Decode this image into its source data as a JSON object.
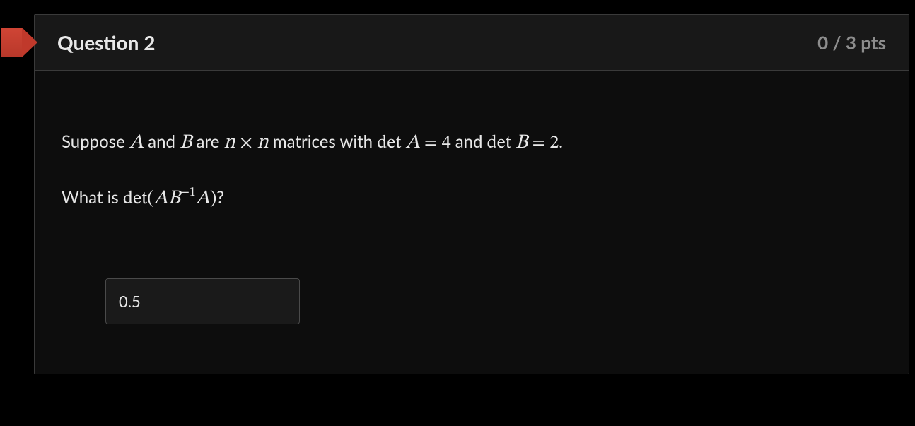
{
  "header": {
    "title": "Question 2",
    "points": "0 / 3 pts"
  },
  "body": {
    "line1_pre": "Suppose ",
    "A": "A",
    "and1": " and ",
    "B": "B",
    "are": " are ",
    "n1": "n",
    "times": " × ",
    "n2": "n",
    "mid1": " matrices with ",
    "det1": "det",
    "sp1": " ",
    "A2": "A",
    "eq1": " = ",
    "v1": "4",
    "and2": " and ",
    "det2": "det",
    "sp2": " ",
    "B2": "B",
    "eq2": " = ",
    "v2": "2",
    "end1": ".",
    "line2_pre": "What is ",
    "det3": "det",
    "open": "(",
    "A3": "A",
    "B3": "B",
    "sup": "−1",
    "A4": "A",
    "close": ")",
    "end2": "?"
  },
  "answer": {
    "value": "0.5"
  }
}
